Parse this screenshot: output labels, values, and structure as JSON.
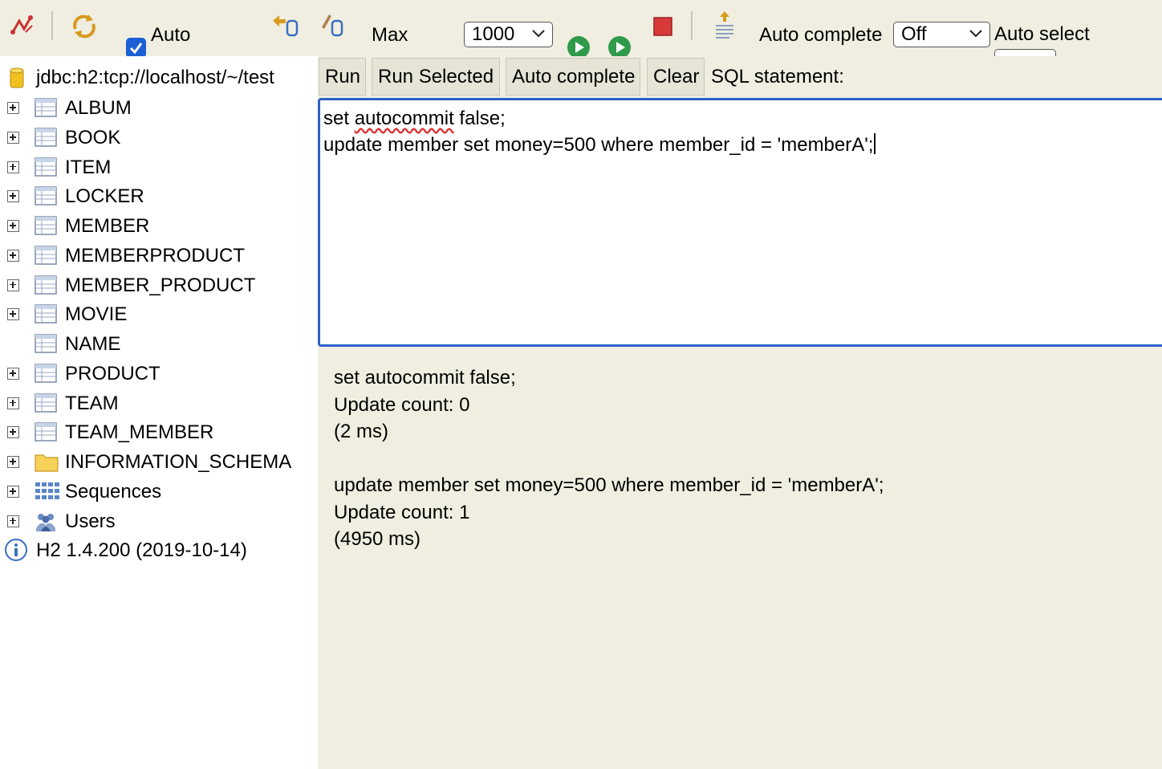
{
  "toolbar": {
    "disconnect_icon": "disconnect-icon",
    "refresh_icon": "refresh-icon",
    "autocommit_label": "Auto",
    "autocommit_checked": true,
    "rollback_icon": "rollback-icon",
    "commit_icon": "commit-icon",
    "max_label": "Max",
    "max_rows_value": "1000",
    "run_icon": "run-icon",
    "run_selected_icon": "run-selected-icon",
    "stop_icon": "stop-icon",
    "history_icon": "history-icon",
    "autocomplete_label": "Auto complete",
    "autocomplete_value": "Off",
    "autoselect_label": "Auto select"
  },
  "tree": {
    "connection": "jdbc:h2:tcp://localhost/~/test",
    "tables": [
      "ALBUM",
      "BOOK",
      "ITEM",
      "LOCKER",
      "MEMBER",
      "MEMBERPRODUCT",
      "MEMBER_PRODUCT",
      "MOVIE",
      "NAME",
      "PRODUCT",
      "TEAM",
      "TEAM_MEMBER"
    ],
    "schema": "INFORMATION_SCHEMA",
    "sequences": "Sequences",
    "users": "Users",
    "version": "H2 1.4.200 (2019-10-14)"
  },
  "buttons": {
    "run": "Run",
    "run_selected": "Run Selected",
    "auto_complete": "Auto complete",
    "clear": "Clear",
    "sql_statement_label": "SQL statement:"
  },
  "editor": {
    "line1_prefix": "set ",
    "line1_misspelled": "autocommit",
    "line1_suffix": " false;",
    "line2": "update member set money=500 where member_id = 'memberA';"
  },
  "results": [
    "set autocommit false;",
    "Update count: 0",
    "(2 ms)",
    "",
    "update member set money=500 where member_id = 'memberA';",
    "Update count: 1",
    "(4950 ms)"
  ],
  "colors": {
    "panel_bg": "#f0eee0",
    "editor_border": "#2d60c8",
    "checkbox": "#1a5fd4",
    "run_green": "#2e9a4a",
    "stop_red": "#d83a3a"
  }
}
